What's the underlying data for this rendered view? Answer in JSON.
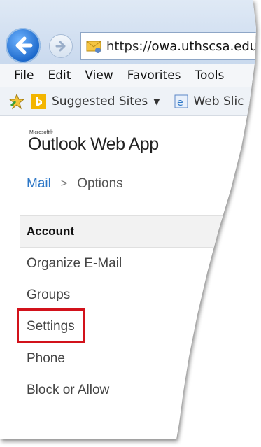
{
  "browser": {
    "address_url": "https://owa.uthscsa.edu/",
    "address_prefix": "https://",
    "address_host": "owa.uthscsa.edu/"
  },
  "menu": {
    "items": [
      "File",
      "Edit",
      "View",
      "Favorites",
      "Tools"
    ]
  },
  "favorites_bar": {
    "suggested_sites": "Suggested Sites",
    "web_slice": "Web Slic"
  },
  "owa": {
    "logo_small": "Microsoft®",
    "logo": "Outlook Web App",
    "breadcrumb": {
      "mail": "Mail",
      "separator": ">",
      "current": "Options"
    },
    "sections": {
      "account": "Account"
    },
    "nav_items": [
      "Organize E-Mail",
      "Groups",
      "Settings",
      "Phone",
      "Block or Allow"
    ]
  },
  "colors": {
    "highlight": "#d2121b",
    "link": "#2e78c7"
  }
}
